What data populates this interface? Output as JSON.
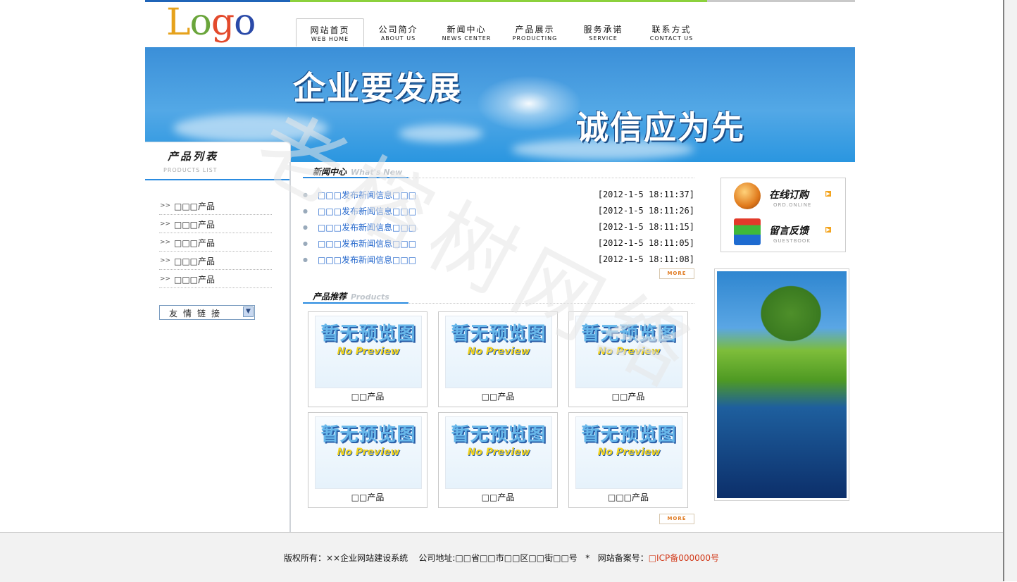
{
  "logo": {
    "text": [
      "L",
      "o",
      "g",
      "o"
    ]
  },
  "nav": [
    {
      "cn": "网站首页",
      "en": "WEB HOME"
    },
    {
      "cn": "公司简介",
      "en": "ABOUT US"
    },
    {
      "cn": "新闻中心",
      "en": "NEWS CENTER"
    },
    {
      "cn": "产品展示",
      "en": "PRODUCTING"
    },
    {
      "cn": "服务承诺",
      "en": "SERVICE"
    },
    {
      "cn": "联系方式",
      "en": "CONTACT US"
    }
  ],
  "banner": {
    "slogan1": "企业要发展",
    "slogan2": "诚信应为先"
  },
  "sidebar": {
    "title": "产品列表",
    "subtitle": "PRODUCTS LIST",
    "items": [
      "□□□产品",
      "□□□产品",
      "□□□产品",
      "□□□产品",
      "□□□产品"
    ],
    "arrow": ">>",
    "links_select": "友情链接"
  },
  "news": {
    "title": "新闻中心",
    "subtitle": "What's New",
    "items": [
      {
        "title": "□□□发布新闻信息□□□",
        "date": "[2012-1-5 18:11:37]"
      },
      {
        "title": "□□□发布新闻信息□□□",
        "date": "[2012-1-5 18:11:26]"
      },
      {
        "title": "□□□发布新闻信息□□□",
        "date": "[2012-1-5 18:11:15]"
      },
      {
        "title": "□□□发布新闻信息□□□",
        "date": "[2012-1-5 18:11:05]"
      },
      {
        "title": "□□□发布新闻信息□□□",
        "date": "[2012-1-5 18:11:08]"
      }
    ],
    "more": "MORE"
  },
  "products": {
    "title": "产品推荐",
    "subtitle": "Products",
    "no_preview_cn": "暂无预览图",
    "no_preview_en": "No Preview",
    "items": [
      "□□产品",
      "□□产品",
      "□□产品",
      "□□产品",
      "□□产品",
      "□□□产品"
    ],
    "more": "MORE"
  },
  "right": {
    "order": {
      "cn": "在线订购",
      "en": "ORD.ONLINE"
    },
    "guestbook": {
      "cn": "留言反馈",
      "en": "GUESTBOOK"
    }
  },
  "footer": {
    "copyright": "版权所有：××企业网站建设系统",
    "address": "公司地址:□□省□□市□□区□□街□□号",
    "sep": "*",
    "icp_label": "网站备案号：",
    "icp": "□ICP备000000号"
  },
  "watermark": "老榕树网络",
  "colors": {
    "accent": "#2a8be0",
    "link": "#2266cc",
    "more": "#e07a20",
    "icp": "#d23a1a"
  }
}
